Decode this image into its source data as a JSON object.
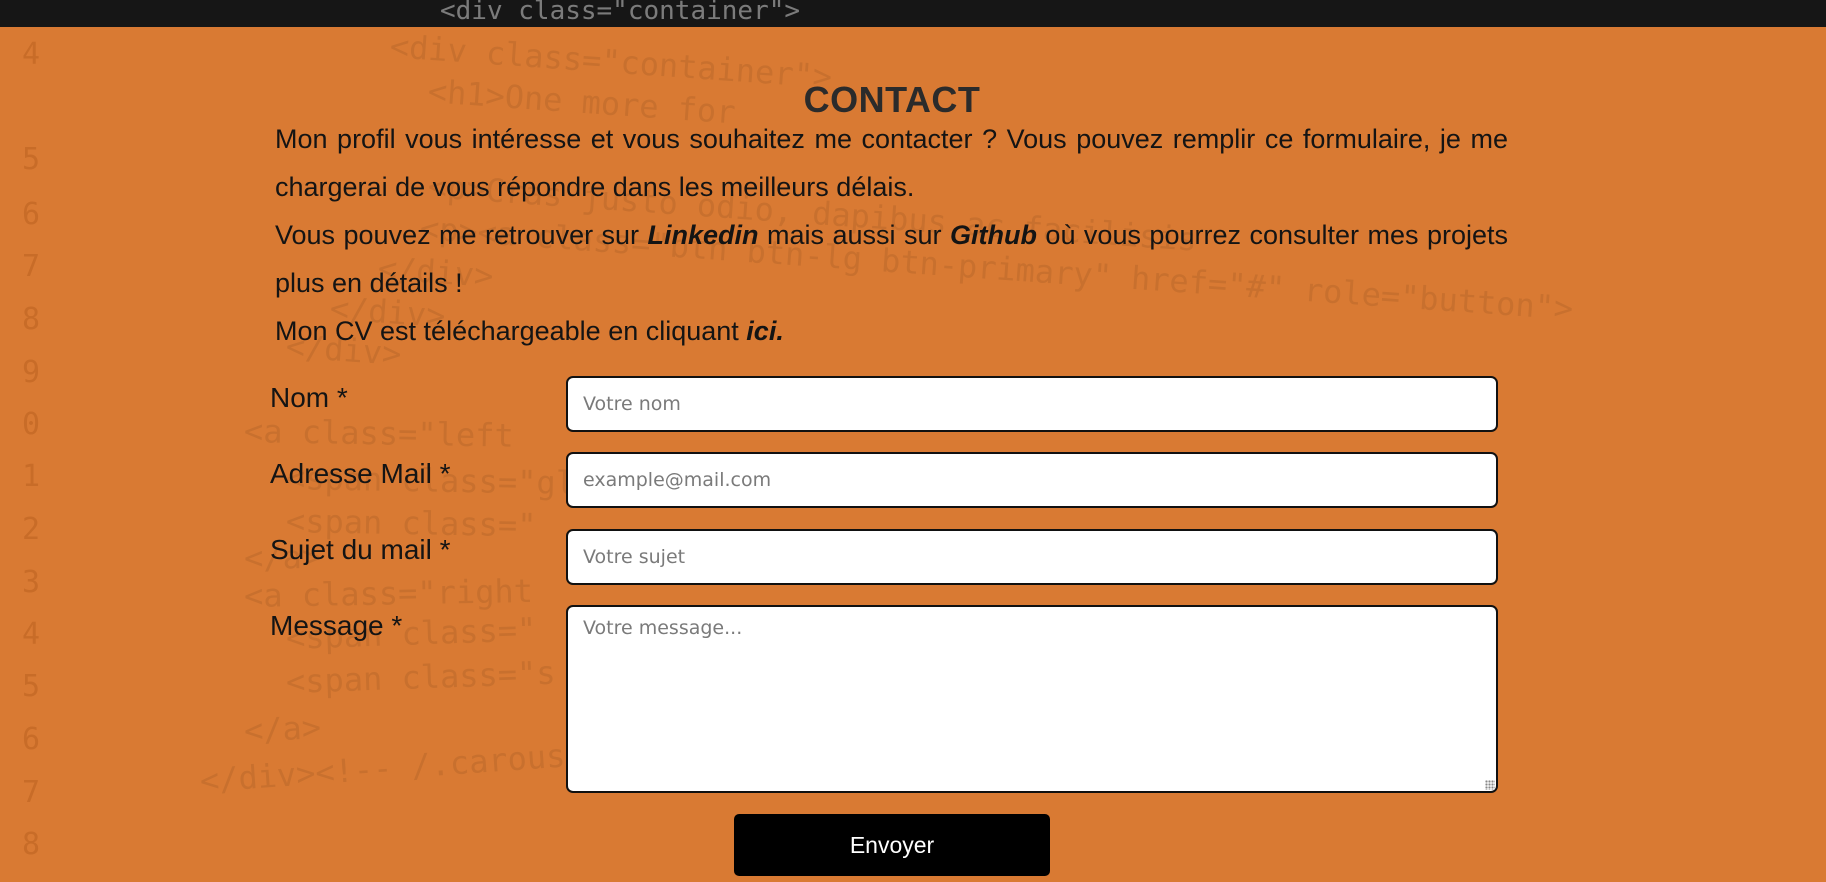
{
  "header": {
    "code_snippet": "<div class=\"container\">"
  },
  "contact": {
    "title": "CONTACT",
    "intro": {
      "p1": "Mon profil vous intéresse et vous souhaitez me contacter ? Vous pouvez remplir ce formulaire, je me chargerai de vous répondre dans les meilleurs délais.",
      "p2_before": "Vous pouvez me retrouver sur ",
      "p2_link1": "Linkedin",
      "p2_middle": " mais aussi sur ",
      "p2_link2": "Github",
      "p2_after": " où vous pourrez consulter mes projets plus en détails !",
      "p3_before": "Mon CV est téléchargeable en cliquant ",
      "p3_link": "ici."
    },
    "form": {
      "name_label": "Nom *",
      "name_placeholder": "Votre nom",
      "email_label": "Adresse Mail *",
      "email_placeholder": "example@mail.com",
      "subject_label": "Sujet du mail *",
      "subject_placeholder": "Votre sujet",
      "message_label": "Message *",
      "message_placeholder": "Votre message...",
      "submit_label": "Envoyer"
    }
  },
  "background_code": {
    "line_numbers": [
      "4",
      "5",
      "6",
      "7",
      "8",
      "9",
      "0",
      "1",
      "2",
      "3",
      "4",
      "5",
      "6",
      "7",
      "8"
    ],
    "lines": [
      "<div class=\"container\">",
      "<h1>One more for",
      "<p>Cras justo odio, dapibus ac facilisis",
      "<p><a class=\"btn btn-lg btn-primary\" href=\"#\" role=\"button\">",
      "</div>",
      "</div>",
      "</div>",
      "<a class=\"left",
      "<span class=\"glyphicon glyphicon-chevron-left\"",
      "<span class=\"",
      "</a>",
      "<a class=\"right",
      "<span class=\"",
      "<span class=\"s",
      "</a>",
      "</div><!-- /.carousel -->"
    ]
  },
  "colors": {
    "section_background": "#d97a33",
    "button_background": "#000000",
    "button_text": "#ffffff",
    "text": "#141414"
  }
}
